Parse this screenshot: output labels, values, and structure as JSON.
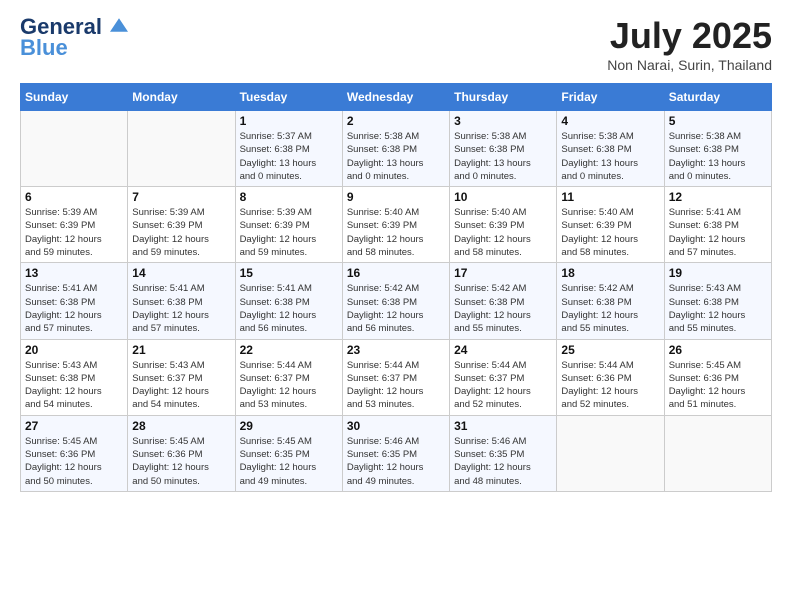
{
  "header": {
    "logo_line1": "General",
    "logo_line2": "Blue",
    "month_year": "July 2025",
    "location": "Non Narai, Surin, Thailand"
  },
  "days_of_week": [
    "Sunday",
    "Monday",
    "Tuesday",
    "Wednesday",
    "Thursday",
    "Friday",
    "Saturday"
  ],
  "weeks": [
    [
      {
        "num": "",
        "info": ""
      },
      {
        "num": "",
        "info": ""
      },
      {
        "num": "1",
        "info": "Sunrise: 5:37 AM\nSunset: 6:38 PM\nDaylight: 13 hours\nand 0 minutes."
      },
      {
        "num": "2",
        "info": "Sunrise: 5:38 AM\nSunset: 6:38 PM\nDaylight: 13 hours\nand 0 minutes."
      },
      {
        "num": "3",
        "info": "Sunrise: 5:38 AM\nSunset: 6:38 PM\nDaylight: 13 hours\nand 0 minutes."
      },
      {
        "num": "4",
        "info": "Sunrise: 5:38 AM\nSunset: 6:38 PM\nDaylight: 13 hours\nand 0 minutes."
      },
      {
        "num": "5",
        "info": "Sunrise: 5:38 AM\nSunset: 6:38 PM\nDaylight: 13 hours\nand 0 minutes."
      }
    ],
    [
      {
        "num": "6",
        "info": "Sunrise: 5:39 AM\nSunset: 6:39 PM\nDaylight: 12 hours\nand 59 minutes."
      },
      {
        "num": "7",
        "info": "Sunrise: 5:39 AM\nSunset: 6:39 PM\nDaylight: 12 hours\nand 59 minutes."
      },
      {
        "num": "8",
        "info": "Sunrise: 5:39 AM\nSunset: 6:39 PM\nDaylight: 12 hours\nand 59 minutes."
      },
      {
        "num": "9",
        "info": "Sunrise: 5:40 AM\nSunset: 6:39 PM\nDaylight: 12 hours\nand 58 minutes."
      },
      {
        "num": "10",
        "info": "Sunrise: 5:40 AM\nSunset: 6:39 PM\nDaylight: 12 hours\nand 58 minutes."
      },
      {
        "num": "11",
        "info": "Sunrise: 5:40 AM\nSunset: 6:39 PM\nDaylight: 12 hours\nand 58 minutes."
      },
      {
        "num": "12",
        "info": "Sunrise: 5:41 AM\nSunset: 6:38 PM\nDaylight: 12 hours\nand 57 minutes."
      }
    ],
    [
      {
        "num": "13",
        "info": "Sunrise: 5:41 AM\nSunset: 6:38 PM\nDaylight: 12 hours\nand 57 minutes."
      },
      {
        "num": "14",
        "info": "Sunrise: 5:41 AM\nSunset: 6:38 PM\nDaylight: 12 hours\nand 57 minutes."
      },
      {
        "num": "15",
        "info": "Sunrise: 5:41 AM\nSunset: 6:38 PM\nDaylight: 12 hours\nand 56 minutes."
      },
      {
        "num": "16",
        "info": "Sunrise: 5:42 AM\nSunset: 6:38 PM\nDaylight: 12 hours\nand 56 minutes."
      },
      {
        "num": "17",
        "info": "Sunrise: 5:42 AM\nSunset: 6:38 PM\nDaylight: 12 hours\nand 55 minutes."
      },
      {
        "num": "18",
        "info": "Sunrise: 5:42 AM\nSunset: 6:38 PM\nDaylight: 12 hours\nand 55 minutes."
      },
      {
        "num": "19",
        "info": "Sunrise: 5:43 AM\nSunset: 6:38 PM\nDaylight: 12 hours\nand 55 minutes."
      }
    ],
    [
      {
        "num": "20",
        "info": "Sunrise: 5:43 AM\nSunset: 6:38 PM\nDaylight: 12 hours\nand 54 minutes."
      },
      {
        "num": "21",
        "info": "Sunrise: 5:43 AM\nSunset: 6:37 PM\nDaylight: 12 hours\nand 54 minutes."
      },
      {
        "num": "22",
        "info": "Sunrise: 5:44 AM\nSunset: 6:37 PM\nDaylight: 12 hours\nand 53 minutes."
      },
      {
        "num": "23",
        "info": "Sunrise: 5:44 AM\nSunset: 6:37 PM\nDaylight: 12 hours\nand 53 minutes."
      },
      {
        "num": "24",
        "info": "Sunrise: 5:44 AM\nSunset: 6:37 PM\nDaylight: 12 hours\nand 52 minutes."
      },
      {
        "num": "25",
        "info": "Sunrise: 5:44 AM\nSunset: 6:36 PM\nDaylight: 12 hours\nand 52 minutes."
      },
      {
        "num": "26",
        "info": "Sunrise: 5:45 AM\nSunset: 6:36 PM\nDaylight: 12 hours\nand 51 minutes."
      }
    ],
    [
      {
        "num": "27",
        "info": "Sunrise: 5:45 AM\nSunset: 6:36 PM\nDaylight: 12 hours\nand 50 minutes."
      },
      {
        "num": "28",
        "info": "Sunrise: 5:45 AM\nSunset: 6:36 PM\nDaylight: 12 hours\nand 50 minutes."
      },
      {
        "num": "29",
        "info": "Sunrise: 5:45 AM\nSunset: 6:35 PM\nDaylight: 12 hours\nand 49 minutes."
      },
      {
        "num": "30",
        "info": "Sunrise: 5:46 AM\nSunset: 6:35 PM\nDaylight: 12 hours\nand 49 minutes."
      },
      {
        "num": "31",
        "info": "Sunrise: 5:46 AM\nSunset: 6:35 PM\nDaylight: 12 hours\nand 48 minutes."
      },
      {
        "num": "",
        "info": ""
      },
      {
        "num": "",
        "info": ""
      }
    ]
  ]
}
